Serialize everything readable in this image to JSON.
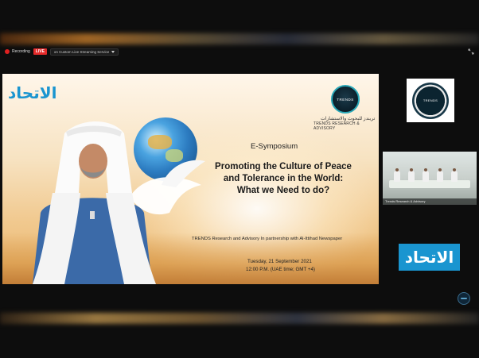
{
  "toolbar": {
    "recording_label": "Recording",
    "live_badge": "LIVE",
    "stream_service": "on Custom Live Streaming Service"
  },
  "main_video": {
    "etihad_logo_text": "الاتحاد",
    "trends_logo_text": "TRENDS",
    "trends_arabic": "تريندز للبحوث والاستشارات",
    "trends_english": "TRENDS RESEARCH & ADVISORY",
    "event_type": "E-Symposium",
    "headline_line1": "Promoting the Culture of Peace",
    "headline_line2": "and Tolerance in the World:",
    "headline_line3": "What we Need to do?",
    "partnership": "TRENDS Research and Advisory In partnership with Al-Ittihad Newspaper",
    "date": "Tuesday, 21 September 2021",
    "time": "12:00 P.M. (UAE time; GMT +4)"
  },
  "side_panel": {
    "trends_logo_text": "TRENDS",
    "room_caption": "Trends Research & Advisory",
    "etihad_logo_text": "الاتحاد"
  },
  "colors": {
    "live_red": "#e52b2b",
    "etihad_blue": "#1a95d0",
    "trends_teal": "#2aa8b8"
  },
  "icons": {
    "expand": "expand-arrows-icon",
    "caret": "chevron-down-icon",
    "recording": "recording-dot-icon"
  }
}
